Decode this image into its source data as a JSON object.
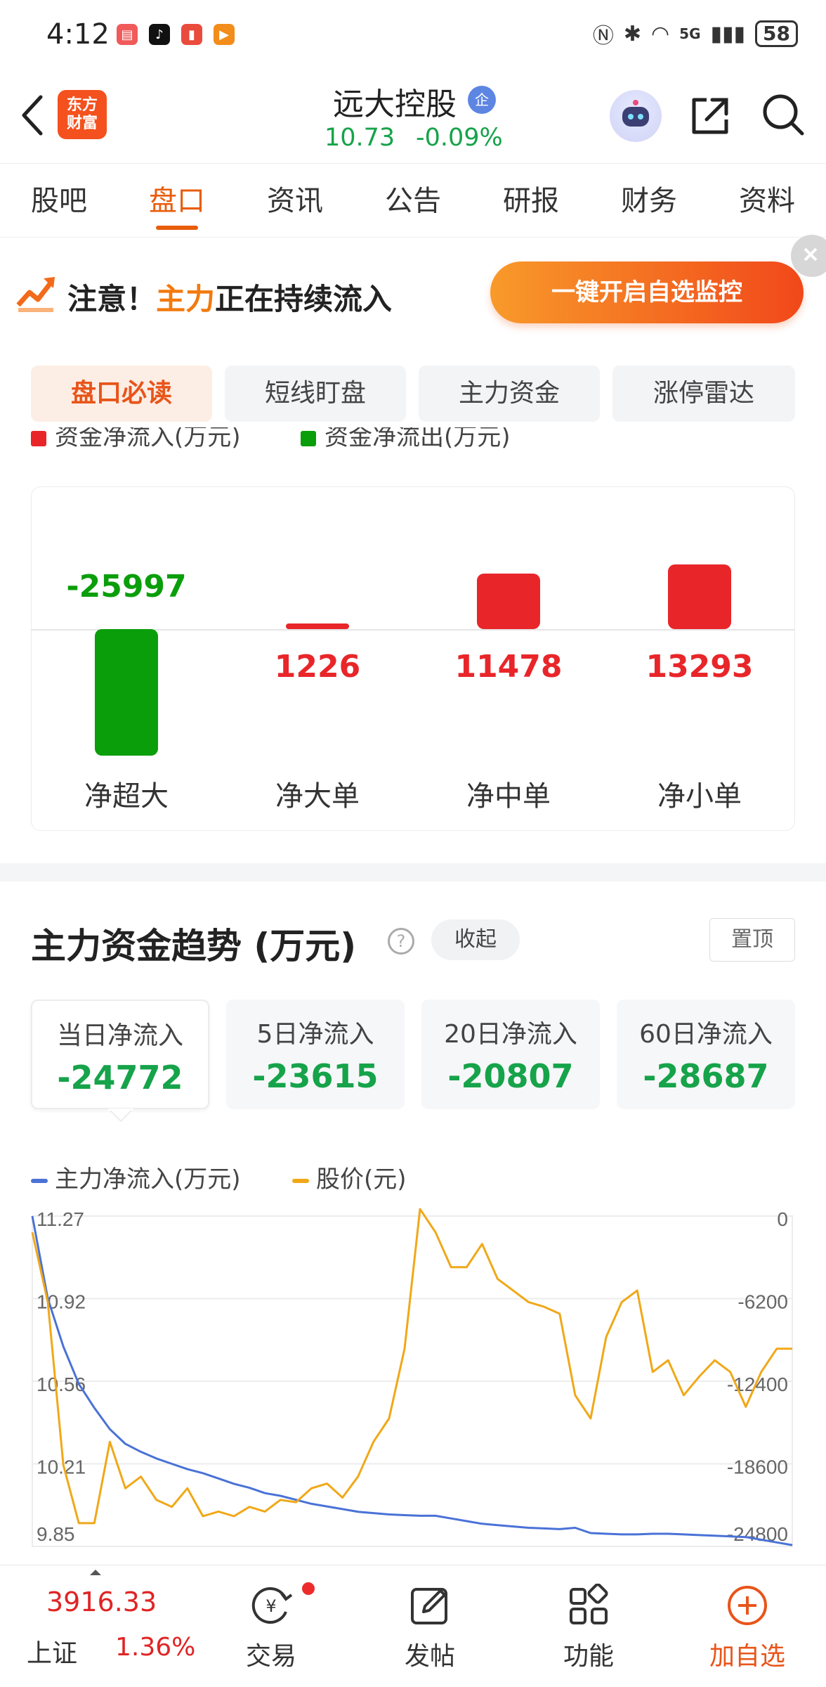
{
  "status_bar": {
    "time": "4:12",
    "battery": "58",
    "network": "5G"
  },
  "header": {
    "stock_name": "远大控股",
    "corp_badge": "企",
    "price": "10.73",
    "change": "-0.09%",
    "logo_text": "东方财富"
  },
  "tabs": [
    "股吧",
    "盘口",
    "资讯",
    "公告",
    "研报",
    "财务",
    "资料"
  ],
  "active_tab": "盘口",
  "alert": {
    "prefix": "注意！",
    "highlight": "主力",
    "suffix": "正在持续流入",
    "button": "一键开启自选监控"
  },
  "sub_tabs": [
    "盘口必读",
    "短线盯盘",
    "主力资金",
    "涨停雷达"
  ],
  "bar_legend": {
    "inflow": "资金净流入(万元)",
    "outflow": "资金净流出(万元)"
  },
  "colors": {
    "up": "#e8262a",
    "down": "#0a9e0a",
    "accent": "#e85d0c",
    "line_main": "#4a72d6",
    "line_price": "#f0a818"
  },
  "chart_data": [
    {
      "type": "bar",
      "categories": [
        "净超大",
        "净大单",
        "净中单",
        "净小单"
      ],
      "values": [
        -25997,
        1226,
        11478,
        13293
      ],
      "labels": [
        "-25997",
        "1226",
        "11478",
        "13293"
      ]
    },
    {
      "type": "line",
      "legend": [
        "主力净流入(万元)",
        "股价(元)"
      ],
      "y_left_ticks": [
        "11.27",
        "10.92",
        "10.56",
        "10.21",
        "9.85"
      ],
      "y_right_ticks": [
        "0",
        "-6200",
        "-12400",
        "-18600",
        "-24800"
      ],
      "y_left_range": [
        9.85,
        11.27
      ],
      "y_right_range": [
        -24800,
        0
      ],
      "series": [
        {
          "name": "主力净流入(万元)",
          "axis": "right",
          "values": [
            0,
            -6200,
            -9800,
            -12600,
            -14400,
            -16000,
            -17100,
            -17700,
            -18200,
            -18600,
            -19000,
            -19300,
            -19700,
            -20100,
            -20400,
            -20800,
            -21000,
            -21300,
            -21600,
            -21800,
            -22000,
            -22200,
            -22300,
            -22400,
            -22450,
            -22500,
            -22500,
            -22700,
            -22900,
            -23100,
            -23200,
            -23300,
            -23400,
            -23450,
            -23500,
            -23400,
            -23800,
            -23850,
            -23900,
            -23900,
            -23850,
            -23850,
            -23900,
            -23950,
            -24000,
            -24050,
            -24100,
            -24300,
            -24500,
            -24700
          ]
        },
        {
          "name": "股价(元)",
          "axis": "left",
          "values": [
            11.2,
            10.9,
            10.2,
            9.95,
            9.95,
            10.3,
            10.1,
            10.15,
            10.05,
            10.02,
            10.1,
            9.98,
            10.0,
            9.98,
            10.02,
            10.0,
            10.05,
            10.04,
            10.1,
            10.12,
            10.06,
            10.15,
            10.3,
            10.4,
            10.7,
            11.3,
            11.2,
            11.05,
            11.05,
            11.15,
            11.0,
            10.95,
            10.9,
            10.88,
            10.85,
            10.5,
            10.4,
            10.75,
            10.9,
            10.95,
            10.6,
            10.65,
            10.5,
            10.58,
            10.65,
            10.6,
            10.45,
            10.6,
            10.7,
            10.7
          ]
        }
      ]
    }
  ],
  "trend": {
    "title": "主力资金趋势 (万元)",
    "help": "?",
    "collapse": "收起",
    "pin": "置顶",
    "cards": [
      {
        "label": "当日净流入",
        "value": "-24772"
      },
      {
        "label": "5日净流入",
        "value": "-23615"
      },
      {
        "label": "20日净流入",
        "value": "-20807"
      },
      {
        "label": "60日净流入",
        "value": "-28687"
      }
    ]
  },
  "bottom_bar": {
    "index_value": "3916.33",
    "index_name": "上证",
    "index_change": "1.36%",
    "items": [
      "交易",
      "发帖",
      "功能",
      "加自选"
    ]
  }
}
